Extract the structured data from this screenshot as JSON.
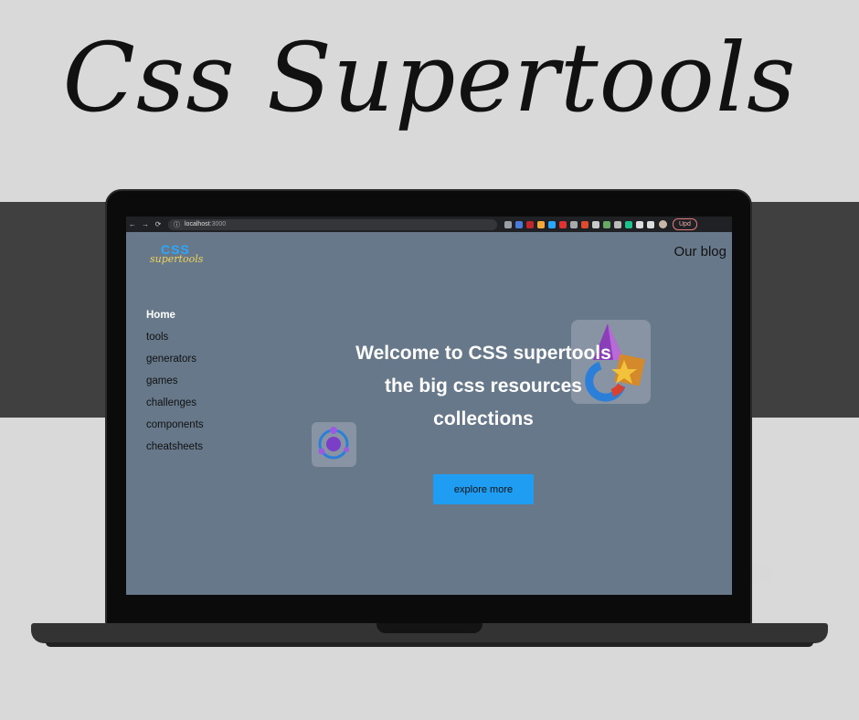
{
  "poster": {
    "title": "Css Supertools"
  },
  "browser": {
    "url_host": "localhost",
    "url_port": ":3000",
    "update_label": "Upd",
    "nav": {
      "back": "←",
      "forward": "→",
      "reload": "⟳"
    },
    "extension_colors": [
      "#9aa0a6",
      "#4b7bd8",
      "#c2272d",
      "#f2a83a",
      "#2aa8ff",
      "#d33",
      "#aaa",
      "#e04b2f",
      "#c9c9c9",
      "#6a6",
      "#bbb",
      "#1ec28b",
      "#ddd",
      "#ddd"
    ]
  },
  "site": {
    "logo": {
      "css": "CSS",
      "sub": "supertools"
    },
    "blog_link": "Our blog",
    "sidebar": [
      {
        "label": "Home",
        "active": true
      },
      {
        "label": "tools"
      },
      {
        "label": "generators"
      },
      {
        "label": "games"
      },
      {
        "label": "challenges"
      },
      {
        "label": "components"
      },
      {
        "label": "cheatsheets"
      }
    ],
    "hero": {
      "line1": "Welcome to CSS supertools",
      "line2": "the big css resources",
      "line3": "collections"
    },
    "cta_label": "explore more"
  },
  "colors": {
    "screen_bg": "#66788a",
    "accent": "#1e9df2",
    "logo_css": "#2aa8ff",
    "logo_sub": "#f2d35a"
  }
}
